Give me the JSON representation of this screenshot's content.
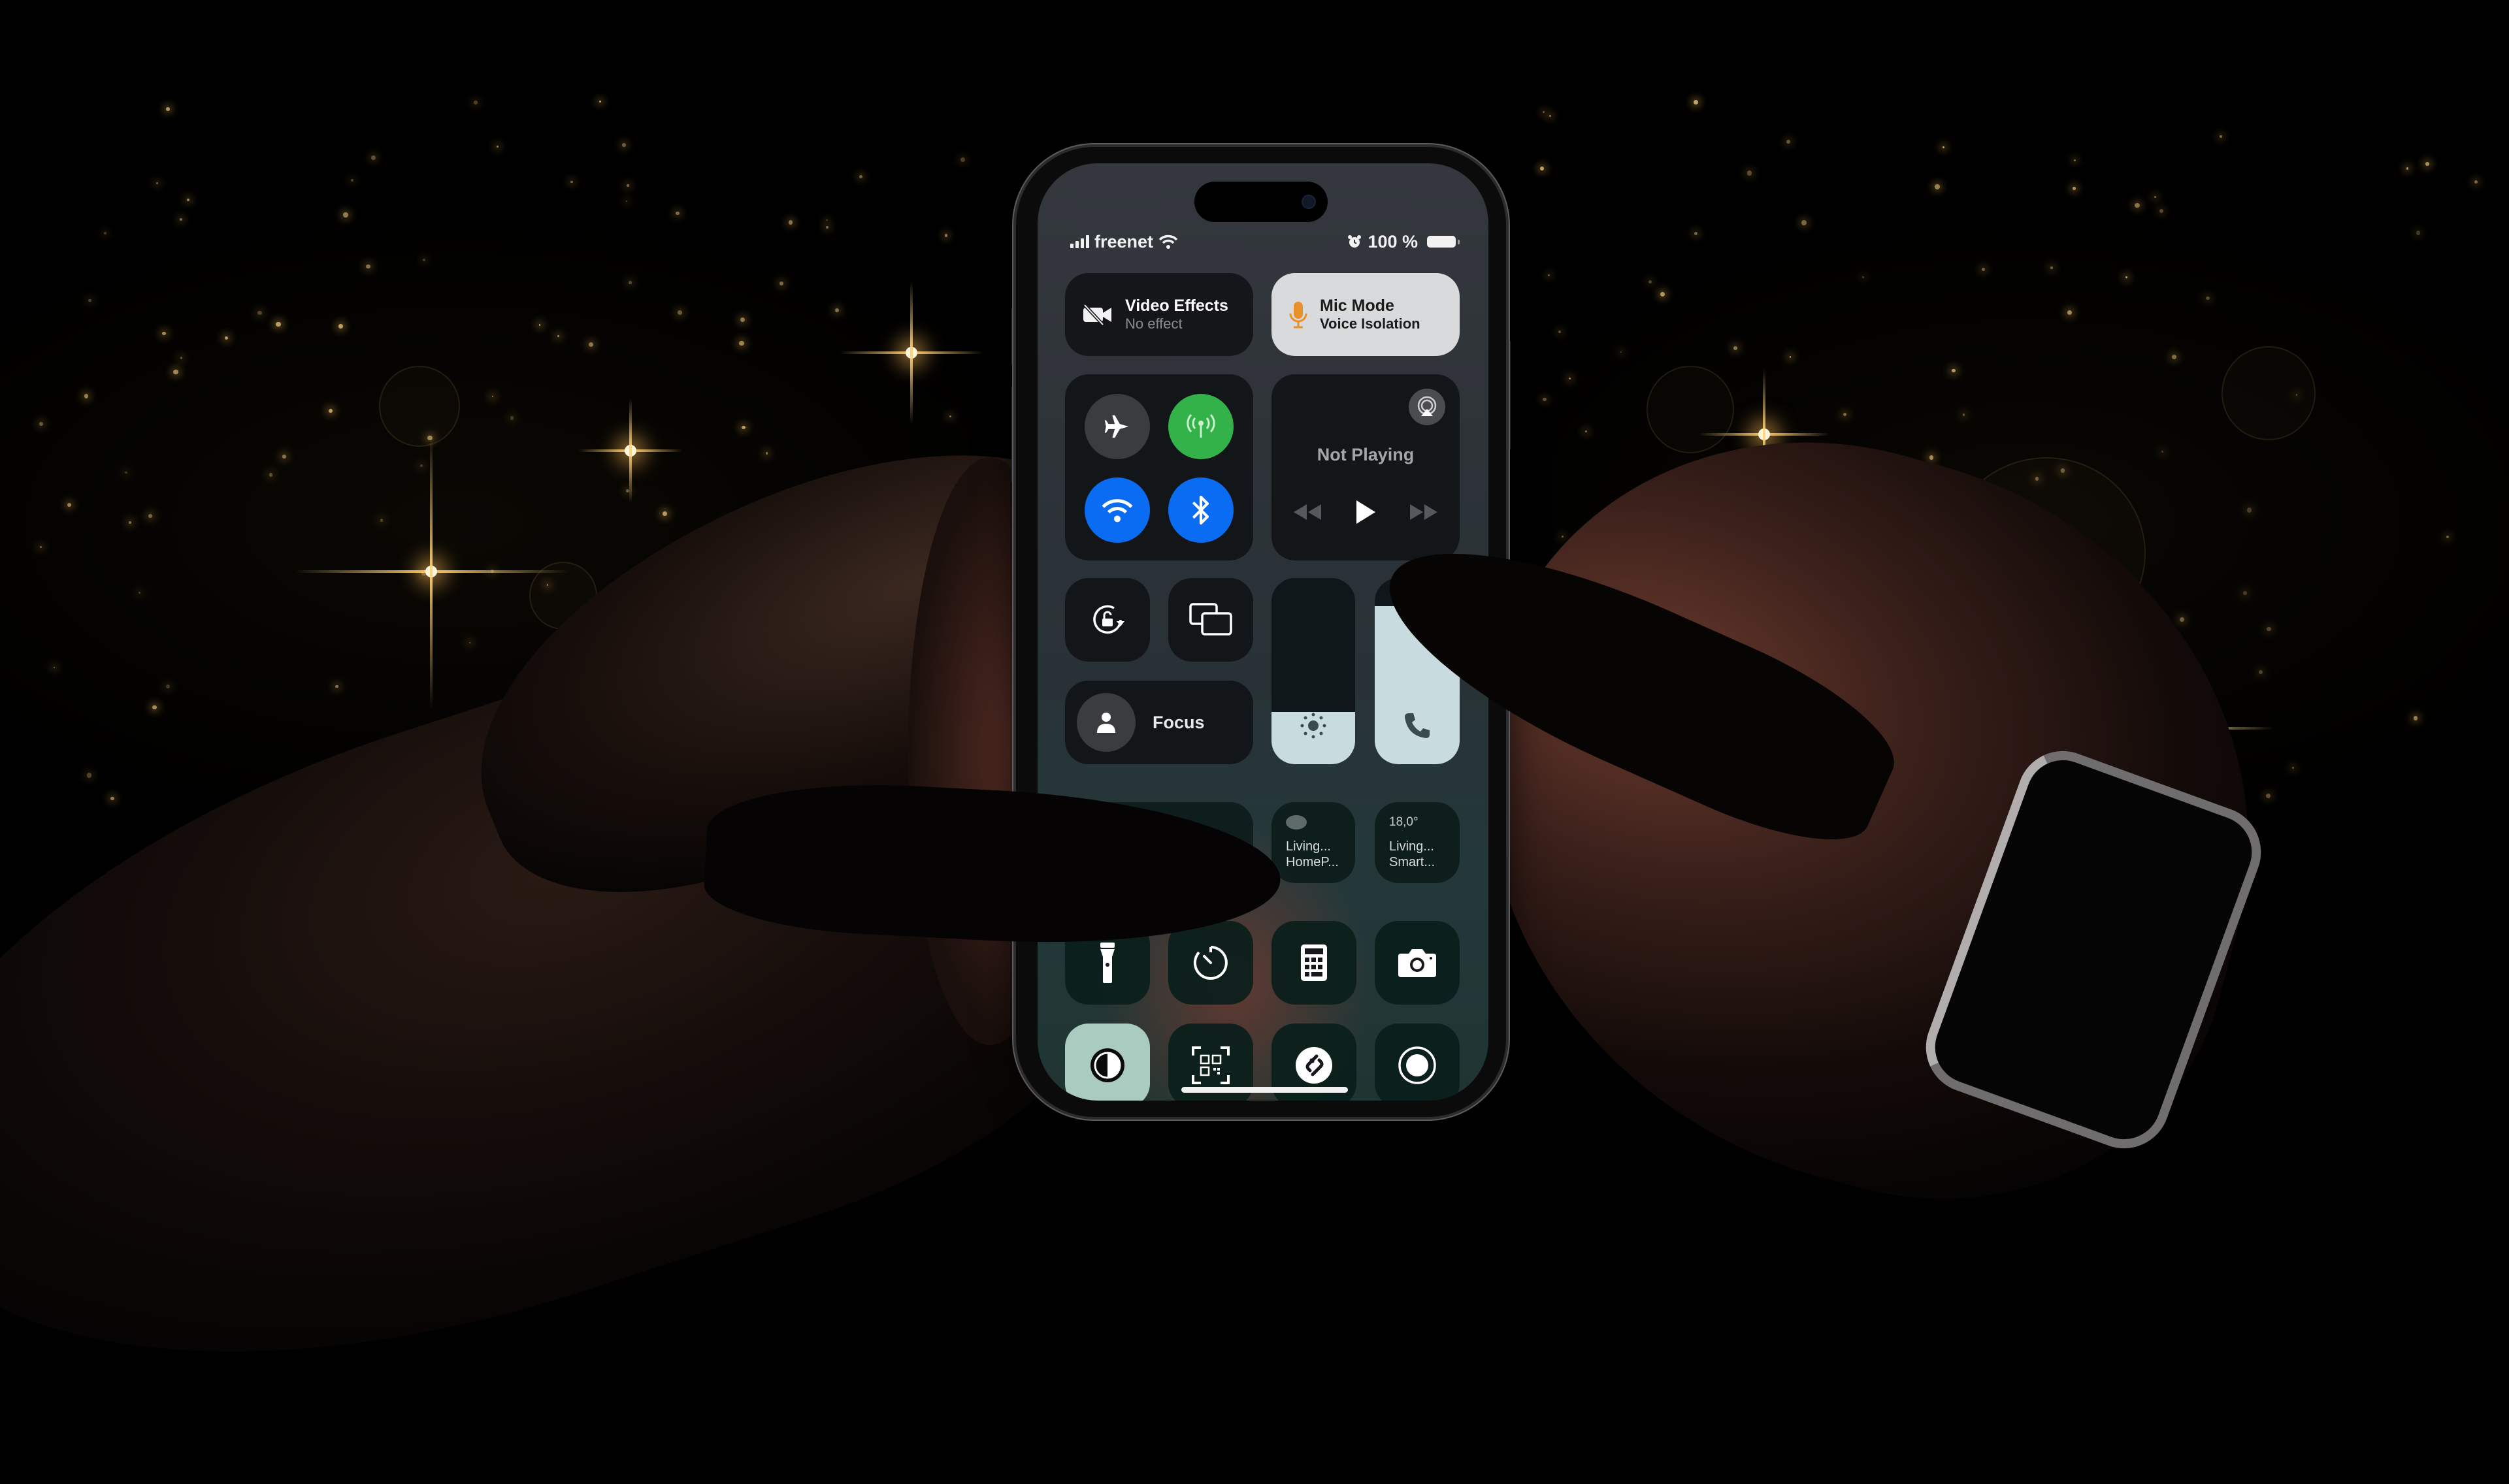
{
  "status_bar": {
    "carrier": "freenet",
    "battery_text": "100 %",
    "signal_bars": 4,
    "wifi": true,
    "alarm": true,
    "battery_level": 1.0
  },
  "control_center": {
    "video_effects": {
      "title": "Video Effects",
      "subtitle": "No effect",
      "icon": "video-slash-icon"
    },
    "mic_mode": {
      "title": "Mic Mode",
      "subtitle": "Voice Isolation",
      "icon": "microphone-icon",
      "icon_color": "#e8902a"
    },
    "connectivity": [
      {
        "name": "airplane-mode",
        "icon": "airplane-icon",
        "active": false,
        "color": "#3a3c3f"
      },
      {
        "name": "cellular-data",
        "icon": "antenna-icon",
        "active": true,
        "color": "#34b24a"
      },
      {
        "name": "wifi",
        "icon": "wifi-icon",
        "active": true,
        "color": "#0a6cf2"
      },
      {
        "name": "bluetooth",
        "icon": "bluetooth-icon",
        "active": true,
        "color": "#0a6cf2"
      }
    ],
    "now_playing": {
      "label": "Not Playing",
      "airplay_icon": "airplay-icon",
      "controls": [
        "rewind",
        "play",
        "fast-forward"
      ]
    },
    "orientation_lock": {
      "icon": "rotation-lock-icon"
    },
    "screen_mirroring": {
      "icon": "screen-mirroring-icon"
    },
    "focus": {
      "label": "Focus",
      "icon": "person-icon"
    },
    "brightness": {
      "icon": "sun-icon",
      "level": 0.28
    },
    "volume": {
      "icon": "phone-icon",
      "level": 0.85
    },
    "home": [
      {
        "line1": "Living...",
        "line2": "HomeP...",
        "icon": "homepod-icon"
      },
      {
        "value": "18,0°",
        "line1": "Living...",
        "line2": "Smart..."
      }
    ],
    "shortcuts_row1": [
      {
        "name": "flashlight",
        "icon": "flashlight-icon"
      },
      {
        "name": "timer",
        "icon": "timer-icon"
      },
      {
        "name": "calculator",
        "icon": "calculator-icon"
      },
      {
        "name": "camera",
        "icon": "camera-icon"
      }
    ],
    "shortcuts_row2": [
      {
        "name": "dark-mode",
        "icon": "dark-mode-icon",
        "active": true
      },
      {
        "name": "code-scanner",
        "icon": "qr-scanner-icon"
      },
      {
        "name": "shazam",
        "icon": "shazam-icon"
      },
      {
        "name": "screen-recording",
        "icon": "record-icon"
      }
    ]
  },
  "colors": {
    "accent_blue": "#0a6cf2",
    "accent_green": "#34b24a",
    "mic_orange": "#e8902a",
    "sparkle_gold": "#d9b570"
  }
}
